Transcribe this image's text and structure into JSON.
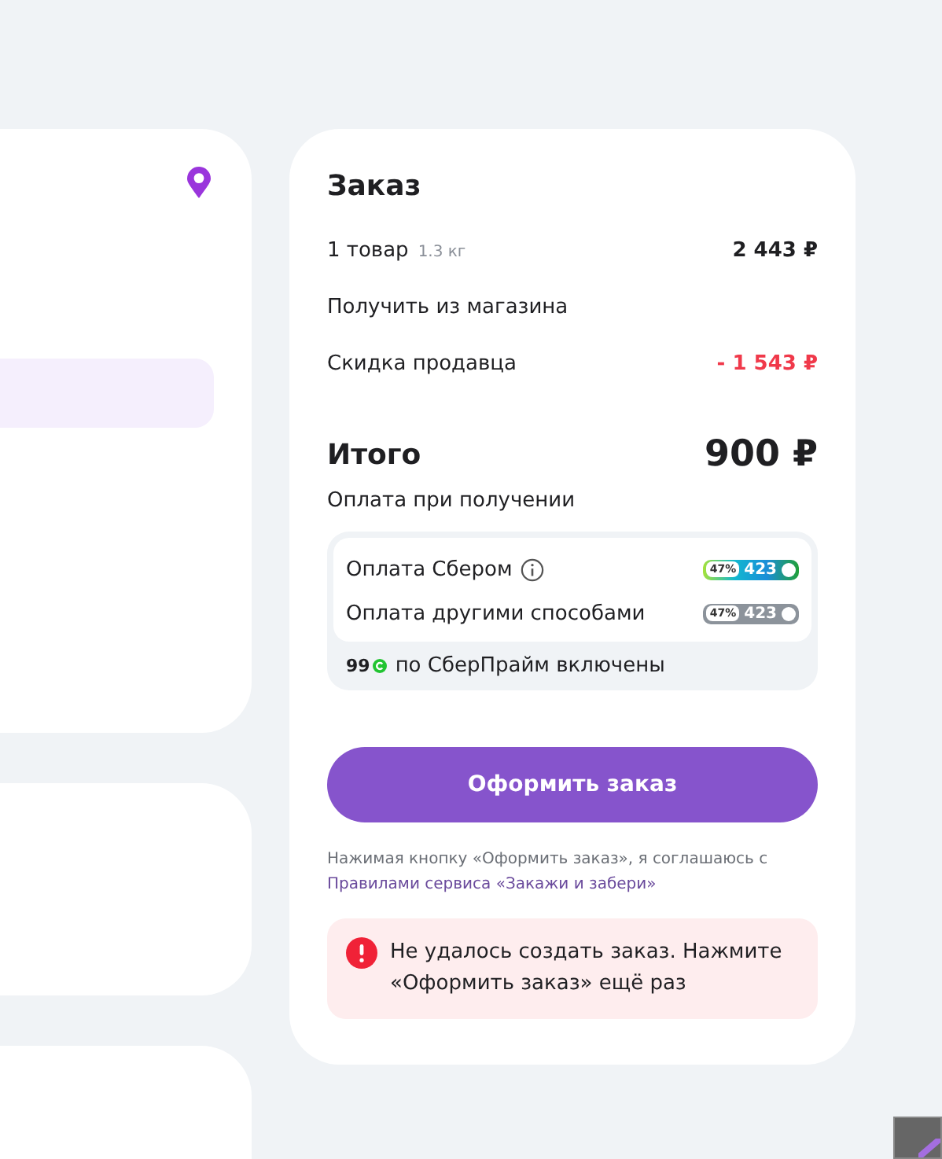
{
  "order": {
    "title": "Заказ",
    "lines": [
      {
        "kind": "items",
        "label": "1 товар",
        "note": "1.3 кг",
        "value": "2 443 ₽"
      },
      {
        "kind": "plain",
        "label": "Получить из магазина"
      },
      {
        "kind": "discount",
        "label": "Скидка продавца",
        "value": "- 1 543 ₽"
      }
    ],
    "total": {
      "label": "Итого",
      "value": "900 ₽"
    },
    "payment_label": "Оплата при получении",
    "payment_options": [
      {
        "label": "Оплата Сбером",
        "info": true,
        "highlighted": true,
        "percent": "47%",
        "bonus": "423"
      },
      {
        "label": "Оплата другими способами",
        "info": false,
        "highlighted": false,
        "percent": "47%",
        "bonus": "423"
      }
    ],
    "prime": {
      "amount": "99",
      "text": "по СберПрайм включены"
    },
    "submit": "Оформить заказ",
    "legal": {
      "text": "Нажимая кнопку «Оформить заказ», я соглашаюсь с",
      "link": "Правилами сервиса «Закажи и забери»"
    },
    "error": "Не удалось создать заказ. Нажмите «Оформить заказ» ещё раз"
  }
}
